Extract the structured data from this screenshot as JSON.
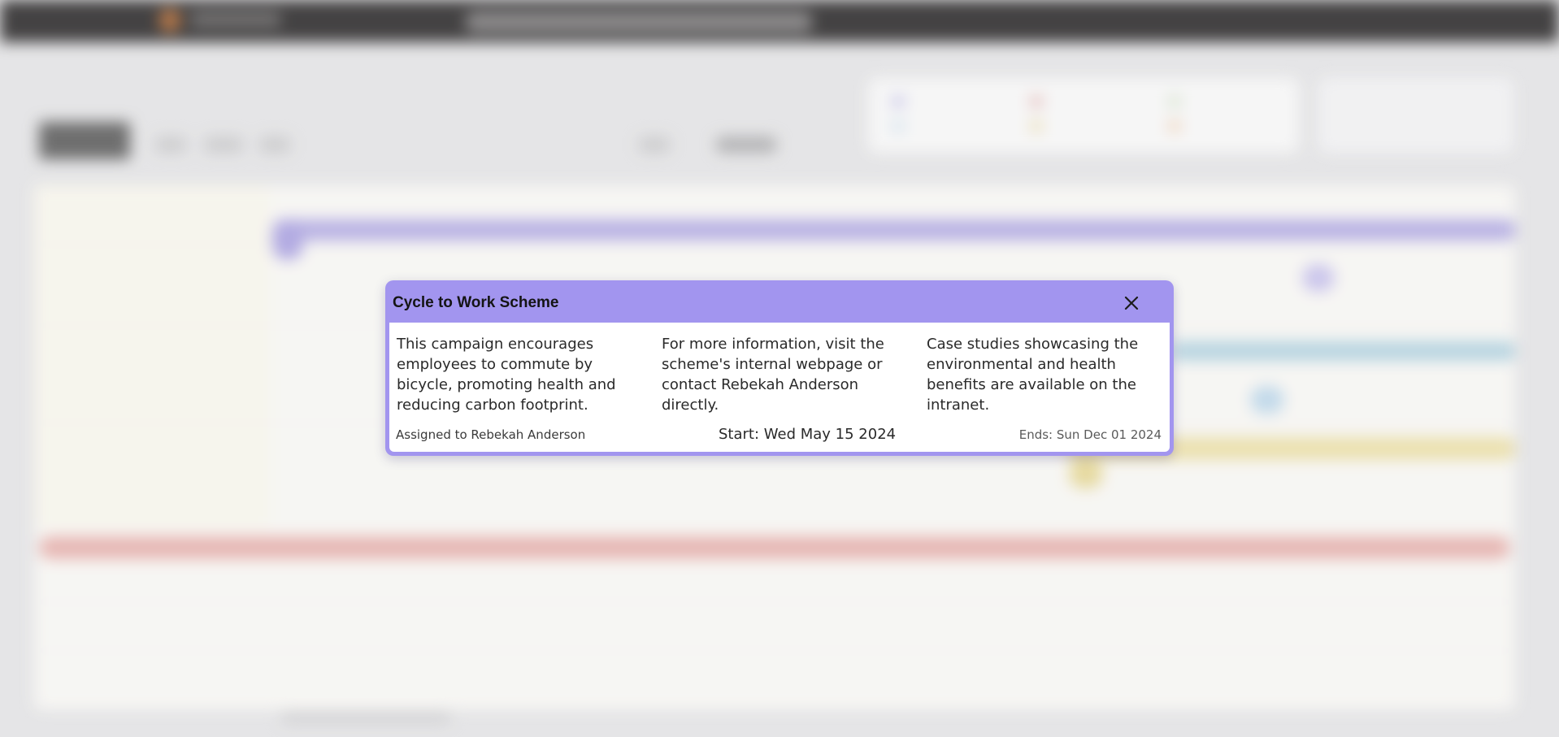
{
  "modal": {
    "title": "Cycle to Work Scheme",
    "columns": [
      "This campaign encourages employees to commute by bicycle, promoting health and reducing carbon footprint.",
      "For more information, visit the scheme's internal webpage or contact Rebekah Anderson directly.",
      "Case studies showcasing the environmental and health benefits are available on the intranet."
    ],
    "assigned": "Assigned to Rebekah Anderson",
    "start": "Start: Wed May 15 2024",
    "ends": "Ends: Sun Dec 01 2024",
    "close_icon": "close-icon"
  },
  "colors": {
    "modal_header": "#a295ef",
    "timeline_purple": "#b0a8e4",
    "timeline_blue": "#aed1e0",
    "timeline_yellow": "#ede0a4",
    "timeline_red": "#e8aeaa",
    "topbar": "#211f20"
  }
}
